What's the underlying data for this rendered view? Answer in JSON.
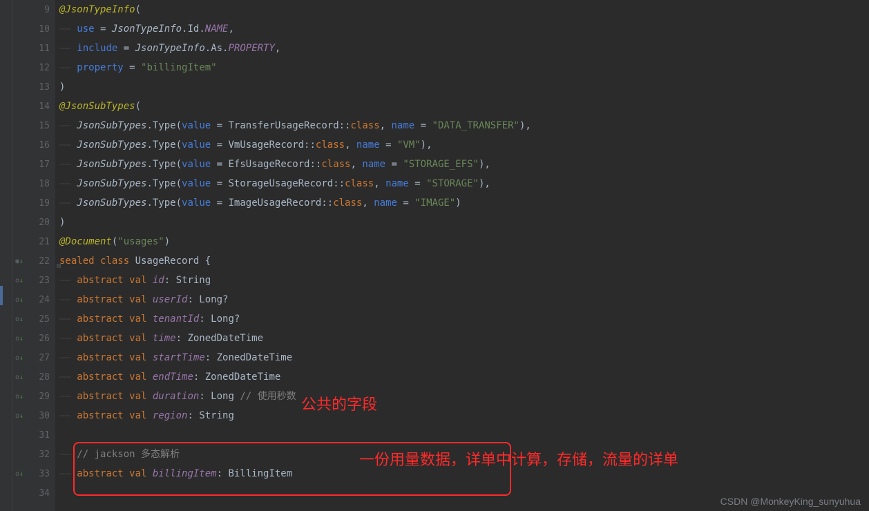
{
  "lines": [
    {
      "n": 9,
      "indent": 0,
      "segments": [
        {
          "c": "annotation",
          "t": "@JsonTypeInfo"
        },
        {
          "c": "punct",
          "t": "("
        }
      ]
    },
    {
      "n": 10,
      "indent": 1,
      "segments": [
        {
          "c": "param",
          "t": "use"
        },
        {
          "c": "punct",
          "t": " = "
        },
        {
          "c": "italic",
          "t": "JsonTypeInfo"
        },
        {
          "c": "punct",
          "t": ".Id."
        },
        {
          "c": "constant",
          "t": "NAME"
        },
        {
          "c": "punct",
          "t": ","
        }
      ]
    },
    {
      "n": 11,
      "indent": 1,
      "segments": [
        {
          "c": "param",
          "t": "include"
        },
        {
          "c": "punct",
          "t": " = "
        },
        {
          "c": "italic",
          "t": "JsonTypeInfo"
        },
        {
          "c": "punct",
          "t": ".As."
        },
        {
          "c": "constant",
          "t": "PROPERTY"
        },
        {
          "c": "punct",
          "t": ","
        }
      ]
    },
    {
      "n": 12,
      "indent": 1,
      "segments": [
        {
          "c": "param",
          "t": "property"
        },
        {
          "c": "punct",
          "t": " = "
        },
        {
          "c": "string",
          "t": "\"billingItem\""
        }
      ]
    },
    {
      "n": 13,
      "indent": 0,
      "segments": [
        {
          "c": "punct",
          "t": ")"
        }
      ]
    },
    {
      "n": 14,
      "indent": 0,
      "segments": [
        {
          "c": "annotation",
          "t": "@JsonSubTypes"
        },
        {
          "c": "punct",
          "t": "("
        }
      ]
    },
    {
      "n": 15,
      "indent": 1,
      "segments": [
        {
          "c": "italic",
          "t": "JsonSubTypes"
        },
        {
          "c": "punct",
          "t": ".Type("
        },
        {
          "c": "param",
          "t": "value"
        },
        {
          "c": "punct",
          "t": " = TransferUsageRecord::"
        },
        {
          "c": "keyword",
          "t": "class"
        },
        {
          "c": "punct",
          "t": ", "
        },
        {
          "c": "param",
          "t": "name"
        },
        {
          "c": "punct",
          "t": " = "
        },
        {
          "c": "string",
          "t": "\"DATA_TRANSFER\""
        },
        {
          "c": "punct",
          "t": "),"
        }
      ]
    },
    {
      "n": 16,
      "indent": 1,
      "segments": [
        {
          "c": "italic",
          "t": "JsonSubTypes"
        },
        {
          "c": "punct",
          "t": ".Type("
        },
        {
          "c": "param",
          "t": "value"
        },
        {
          "c": "punct",
          "t": " = VmUsageRecord::"
        },
        {
          "c": "keyword",
          "t": "class"
        },
        {
          "c": "punct",
          "t": ", "
        },
        {
          "c": "param",
          "t": "name"
        },
        {
          "c": "punct",
          "t": " = "
        },
        {
          "c": "string",
          "t": "\"VM\""
        },
        {
          "c": "punct",
          "t": "),"
        }
      ]
    },
    {
      "n": 17,
      "indent": 1,
      "segments": [
        {
          "c": "italic",
          "t": "JsonSubTypes"
        },
        {
          "c": "punct",
          "t": ".Type("
        },
        {
          "c": "param",
          "t": "value"
        },
        {
          "c": "punct",
          "t": " = EfsUsageRecord::"
        },
        {
          "c": "keyword",
          "t": "class"
        },
        {
          "c": "punct",
          "t": ", "
        },
        {
          "c": "param",
          "t": "name"
        },
        {
          "c": "punct",
          "t": " = "
        },
        {
          "c": "string",
          "t": "\"STORAGE_EFS\""
        },
        {
          "c": "punct",
          "t": "),"
        }
      ]
    },
    {
      "n": 18,
      "indent": 1,
      "segments": [
        {
          "c": "italic",
          "t": "JsonSubTypes"
        },
        {
          "c": "punct",
          "t": ".Type("
        },
        {
          "c": "param",
          "t": "value"
        },
        {
          "c": "punct",
          "t": " = StorageUsageRecord::"
        },
        {
          "c": "keyword",
          "t": "class"
        },
        {
          "c": "punct",
          "t": ", "
        },
        {
          "c": "param",
          "t": "name"
        },
        {
          "c": "punct",
          "t": " = "
        },
        {
          "c": "string",
          "t": "\"STORAGE\""
        },
        {
          "c": "punct",
          "t": "),"
        }
      ]
    },
    {
      "n": 19,
      "indent": 1,
      "segments": [
        {
          "c": "italic",
          "t": "JsonSubTypes"
        },
        {
          "c": "punct",
          "t": ".Type("
        },
        {
          "c": "param",
          "t": "value"
        },
        {
          "c": "punct",
          "t": " = ImageUsageRecord::"
        },
        {
          "c": "keyword",
          "t": "class"
        },
        {
          "c": "punct",
          "t": ", "
        },
        {
          "c": "param",
          "t": "name"
        },
        {
          "c": "punct",
          "t": " = "
        },
        {
          "c": "string",
          "t": "\"IMAGE\""
        },
        {
          "c": "punct",
          "t": ")"
        }
      ]
    },
    {
      "n": 20,
      "indent": 0,
      "segments": [
        {
          "c": "punct",
          "t": ")"
        }
      ]
    },
    {
      "n": 21,
      "indent": 0,
      "segments": [
        {
          "c": "annotation",
          "t": "@Document"
        },
        {
          "c": "punct",
          "t": "("
        },
        {
          "c": "string",
          "t": "\"usages\""
        },
        {
          "c": "punct",
          "t": ")"
        }
      ]
    },
    {
      "n": 22,
      "indent": 0,
      "icon": "circle",
      "fold": true,
      "segments": [
        {
          "c": "keyword",
          "t": "sealed class "
        },
        {
          "c": "classname",
          "t": "UsageRecord"
        },
        {
          "c": "punct",
          "t": " {"
        }
      ]
    },
    {
      "n": 23,
      "indent": 1,
      "icon": "arrow",
      "segments": [
        {
          "c": "keyword",
          "t": "abstract val "
        },
        {
          "c": "constant",
          "t": "id"
        },
        {
          "c": "punct",
          "t": ": String"
        }
      ]
    },
    {
      "n": 24,
      "indent": 1,
      "icon": "arrow",
      "segments": [
        {
          "c": "keyword",
          "t": "abstract val "
        },
        {
          "c": "constant",
          "t": "userId"
        },
        {
          "c": "punct",
          "t": ": Long?"
        }
      ]
    },
    {
      "n": 25,
      "indent": 1,
      "icon": "arrow",
      "segments": [
        {
          "c": "keyword",
          "t": "abstract val "
        },
        {
          "c": "constant",
          "t": "tenantId"
        },
        {
          "c": "punct",
          "t": ": Long?"
        }
      ]
    },
    {
      "n": 26,
      "indent": 1,
      "icon": "arrow",
      "segments": [
        {
          "c": "keyword",
          "t": "abstract val "
        },
        {
          "c": "constant",
          "t": "time"
        },
        {
          "c": "punct",
          "t": ": ZonedDateTime"
        }
      ]
    },
    {
      "n": 27,
      "indent": 1,
      "icon": "arrow",
      "segments": [
        {
          "c": "keyword",
          "t": "abstract val "
        },
        {
          "c": "constant",
          "t": "startTime"
        },
        {
          "c": "punct",
          "t": ": ZonedDateTime"
        }
      ]
    },
    {
      "n": 28,
      "indent": 1,
      "icon": "arrow",
      "segments": [
        {
          "c": "keyword",
          "t": "abstract val "
        },
        {
          "c": "constant",
          "t": "endTime"
        },
        {
          "c": "punct",
          "t": ": ZonedDateTime"
        }
      ]
    },
    {
      "n": 29,
      "indent": 1,
      "icon": "arrow",
      "segments": [
        {
          "c": "keyword",
          "t": "abstract val "
        },
        {
          "c": "constant",
          "t": "duration"
        },
        {
          "c": "punct",
          "t": ": Long "
        },
        {
          "c": "comment",
          "t": "// 使用秒数"
        }
      ]
    },
    {
      "n": 30,
      "indent": 1,
      "icon": "arrow",
      "segments": [
        {
          "c": "keyword",
          "t": "abstract val "
        },
        {
          "c": "constant",
          "t": "region"
        },
        {
          "c": "punct",
          "t": ": String"
        }
      ]
    },
    {
      "n": 31,
      "indent": 0,
      "segments": []
    },
    {
      "n": 32,
      "indent": 1,
      "segments": [
        {
          "c": "comment",
          "t": "// jackson 多态解析"
        }
      ]
    },
    {
      "n": 33,
      "indent": 1,
      "icon": "arrow",
      "segments": [
        {
          "c": "keyword",
          "t": "abstract val "
        },
        {
          "c": "constant",
          "t": "billingItem"
        },
        {
          "c": "punct",
          "t": ": BillingItem"
        }
      ]
    },
    {
      "n": 34,
      "indent": 0,
      "segments": []
    }
  ],
  "annotations": {
    "label1": "公共的字段",
    "label2": "一份用量数据，详单中计算，存储，流量的详单"
  },
  "watermark": "CSDN @MonkeyKing_sunyuhua"
}
